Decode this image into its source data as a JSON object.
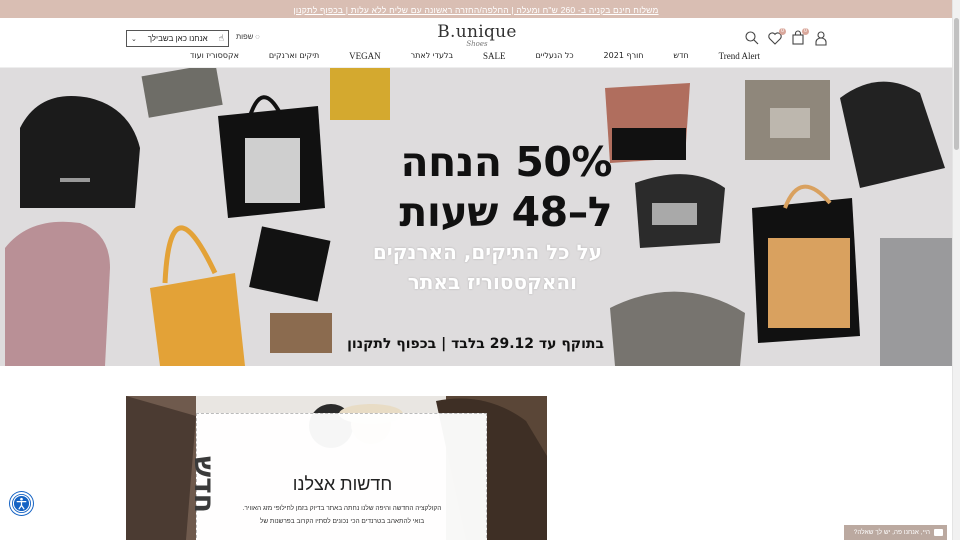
{
  "topbar": {
    "text": "משלוח חינם בקניה ב- 260 ש\"ח ומעלה | החלפה/החזרה ראשונה עם שליח ללא עלות | בכפוף לתקנון"
  },
  "header": {
    "logo_main": "B.unique",
    "logo_sub": "Shoes",
    "cart_count": "0",
    "wishlist_count": "0",
    "language_select": "אנחנו כאן בשבילך",
    "language_label": "שפות"
  },
  "nav": {
    "items": [
      "Trend Alert",
      "חדש",
      "חורף 2021",
      "כל הנעליים",
      "SALE",
      "בלעדי לאתר",
      "VEGAN",
      "תיקים וארנקים",
      "אקססוריז ועוד"
    ]
  },
  "hero": {
    "line1": "50% הנחה",
    "line2": "ל–48 שעות",
    "line3": "על כל התיקים, הארנקים",
    "line4": "והאקססוריז באתר",
    "line5": "בתוקף עד 29.12 בלבד | בכפוף לתקנון"
  },
  "promo": {
    "title": "חדשות אצלנו",
    "text1": "הקולקציה החדשה והיפה שלנו נחתה באתר בדיוק בזמן לחילופי מזג האוויר.",
    "text2": "בואי להתאהב בטרנדים הכי נכונים לסתיו הקרוב בפרשנות של",
    "vertical": "חדש"
  },
  "chat": {
    "label": "היי, אנחנו פה, יש לך שאלה?"
  },
  "colors": {
    "topbar": "#d9beb3",
    "hero_bg": "#dedcdd",
    "accessibility": "#1563c4",
    "chat": "#bba9a0"
  }
}
